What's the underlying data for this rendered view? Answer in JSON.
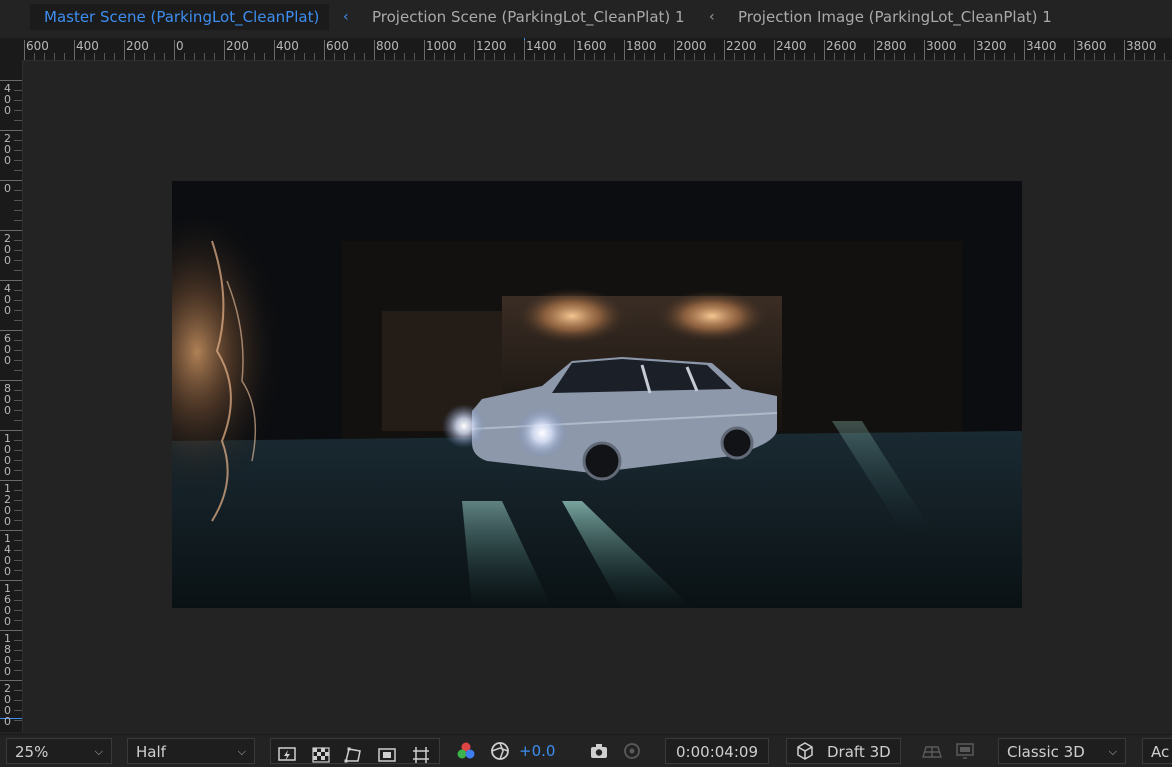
{
  "tabs": {
    "active": "Master Scene (ParkingLot_CleanPlat)",
    "second": "Projection Scene (ParkingLot_CleanPlat) 1",
    "third": "Projection Image (ParkingLot_CleanPlat) 1",
    "chevron": "‹"
  },
  "ruler_h": [
    "600",
    "400",
    "200",
    "0",
    "200",
    "400",
    "600",
    "800",
    "1000",
    "1200",
    "1400",
    "1600",
    "1800",
    "2000",
    "2200",
    "2400",
    "2600",
    "2800",
    "3000",
    "3200",
    "3400",
    "3600",
    "3800"
  ],
  "ruler_v": [
    "400",
    "200",
    "0",
    "200",
    "400",
    "600",
    "800",
    "1000",
    "1200",
    "1400",
    "1600",
    "1800",
    "2000"
  ],
  "viewer": {
    "image": "parking-lot-car-scene"
  },
  "toolbar": {
    "zoom": "25%",
    "resolution": "Half",
    "exposure": "+0.0",
    "timecode": "0:00:04:09",
    "renderer_mode": "Draft 3D",
    "renderer": "Classic 3D",
    "truncated": "Ac"
  },
  "colors": {
    "accent": "#3d8ef0",
    "bg": "#232323"
  }
}
